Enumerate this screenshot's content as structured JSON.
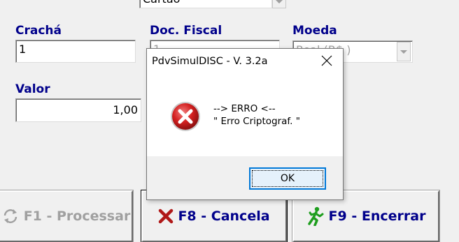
{
  "form": {
    "top_combo_value": "Cartão",
    "cracha_label": "Crachá",
    "cracha_value": "1",
    "doc_fiscal_label": "Doc. Fiscal",
    "doc_fiscal_value": "1",
    "moeda_label": "Moeda",
    "moeda_value": "Real (R$ )",
    "valor_label": "Valor",
    "valor_value": "1,00"
  },
  "actions": {
    "processar_label": "F1 - Processar",
    "cancela_label": "F8 - Cancela",
    "encerrar_label": "F9 - Encerrar"
  },
  "dialog": {
    "title": "PdvSimulDISC - V. 3.2a",
    "message_line1": "--> ERRO <--",
    "message_line2": "\" Erro Criptograf. \"",
    "ok_label": "OK",
    "icon": "error-icon"
  },
  "colors": {
    "label_blue": "#00008b",
    "error_red": "#d42020",
    "ok_border": "#0078d7"
  }
}
